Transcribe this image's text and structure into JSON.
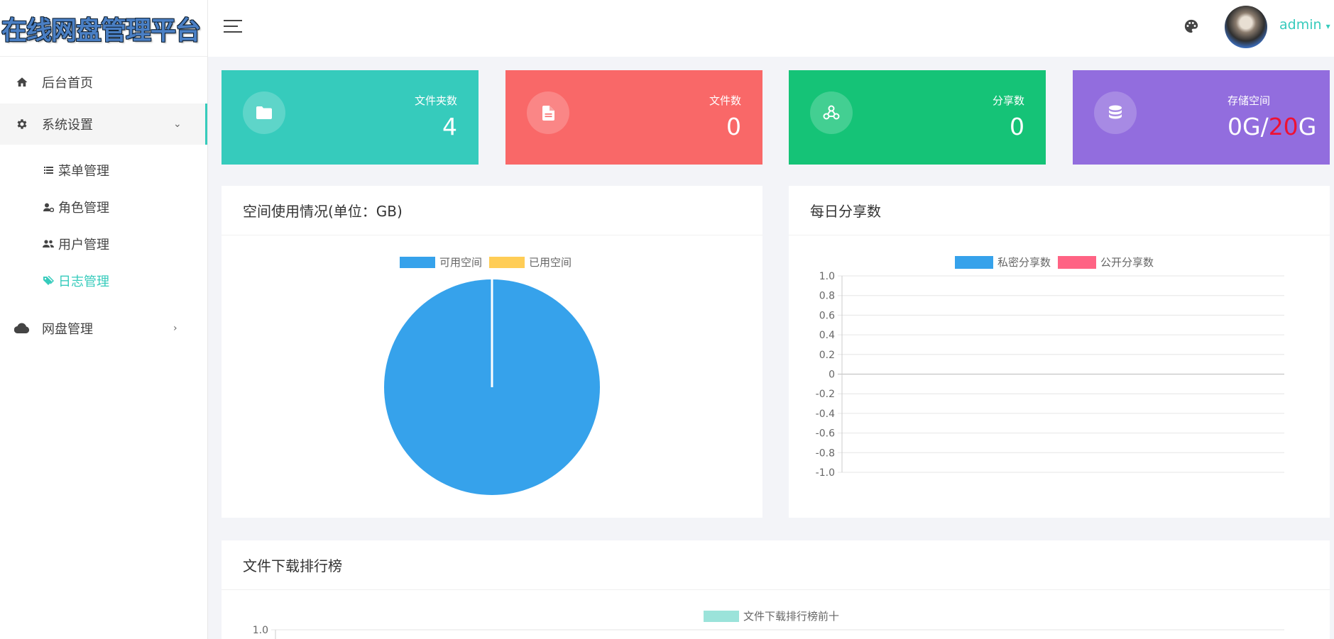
{
  "app": {
    "logo_text": "在线网盘管理平台",
    "user_name": "admin"
  },
  "sidebar": {
    "home": "后台首页",
    "settings": "系统设置",
    "settings_children": [
      "菜单管理",
      "角色管理",
      "用户管理",
      "日志管理"
    ],
    "disk": "网盘管理"
  },
  "stats": [
    {
      "label": "文件夹数",
      "value": "4",
      "color": "#36cbbc",
      "icon": "folder-icon"
    },
    {
      "label": "文件数",
      "value": "0",
      "color": "#f96868",
      "icon": "file-icon"
    },
    {
      "label": "分享数",
      "value": "0",
      "color": "#15c377",
      "icon": "share-icon"
    },
    {
      "label": "存储空间",
      "used": "0G/",
      "total": "20",
      "unit": "G",
      "color": "#926dde",
      "icon": "database-icon"
    }
  ],
  "panels": {
    "space": "空间使用情况(单位：GB)",
    "daily": "每日分享数",
    "ranking": "文件下载排行榜"
  },
  "chart_data": [
    {
      "type": "pie",
      "title": "空间使用情况(单位：GB)",
      "labels": [
        "可用空间",
        "已用空间"
      ],
      "values": [
        20,
        0
      ],
      "colors": [
        "#36a2eb",
        "#ffcd56"
      ]
    },
    {
      "type": "line",
      "title": "每日分享数",
      "series": [
        {
          "name": "私密分享数",
          "values": [],
          "color": "#36a2eb"
        },
        {
          "name": "公开分享数",
          "values": [],
          "color": "#ff6384"
        }
      ],
      "ylim": [
        -1.0,
        1.0
      ],
      "yticks": [
        "1.0",
        "0.8",
        "0.6",
        "0.4",
        "0.2",
        "0",
        "-0.2",
        "-0.4",
        "-0.6",
        "-0.8",
        "-1.0"
      ],
      "grid": true,
      "legend": "top"
    },
    {
      "type": "bar",
      "title": "文件下载排行榜",
      "series": [
        {
          "name": "文件下载排行榜前十",
          "values": [],
          "color": "#9be3da"
        }
      ],
      "yticks": [
        "1.0"
      ],
      "legend": "top"
    }
  ]
}
